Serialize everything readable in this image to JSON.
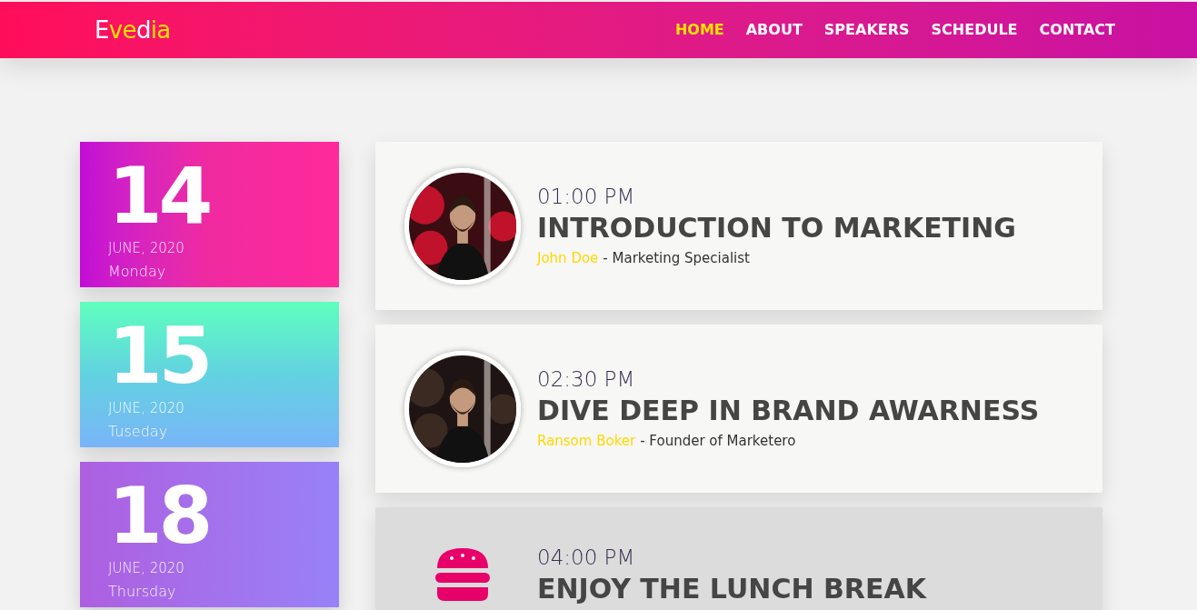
{
  "header": {
    "logo": [
      {
        "text": "E",
        "accent": false
      },
      {
        "text": "ve",
        "accent": true
      },
      {
        "text": "d",
        "accent": false
      },
      {
        "text": "ia",
        "accent": true
      }
    ],
    "nav": [
      {
        "label": "HOME",
        "selected": true
      },
      {
        "label": "ABOUT",
        "selected": false
      },
      {
        "label": "SPEAKERS",
        "selected": false
      },
      {
        "label": "SCHEDULE",
        "selected": false
      },
      {
        "label": "CONTACT",
        "selected": false
      }
    ]
  },
  "dates": [
    {
      "day": "14",
      "month": "JUNE, 2020",
      "weekday": "Monday"
    },
    {
      "day": "15",
      "month": "JUNE, 2020",
      "weekday": "Tuseday"
    },
    {
      "day": "18",
      "month": "JUNE, 2020",
      "weekday": "Thursday"
    }
  ],
  "sessions": [
    {
      "kind": "talk",
      "time": "01:00 PM",
      "title": "INTRODUCTION TO MARKETING",
      "speaker": "John Doe",
      "role": "- Marketing Specialist"
    },
    {
      "kind": "talk",
      "time": "02:30 PM",
      "title": "DIVE DEEP IN BRAND AWARNESS",
      "speaker": "Ransom Boker",
      "role": "- Founder of Marketero"
    },
    {
      "kind": "break",
      "time": "04:00 PM",
      "title": "ENJOY THE LUNCH BREAK"
    }
  ]
}
